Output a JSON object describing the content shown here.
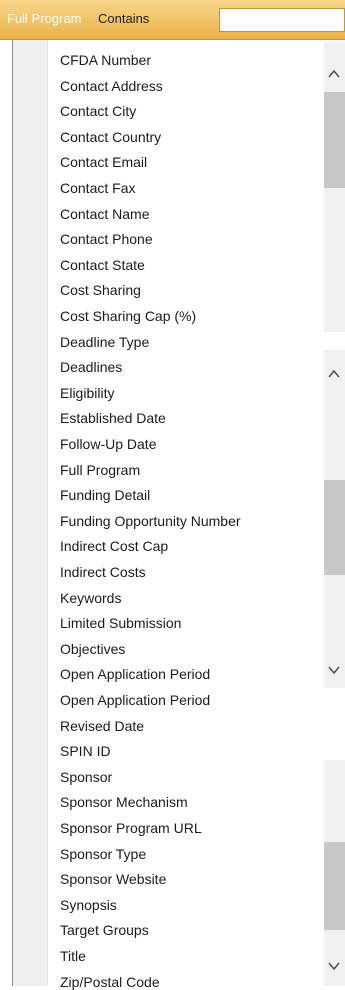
{
  "filter": {
    "field": "Full Program",
    "operator": "Contains",
    "value": ""
  },
  "options": [
    "CFDA Number",
    "Contact Address",
    "Contact City",
    "Contact Country",
    "Contact Email",
    "Contact Fax",
    "Contact Name",
    "Contact Phone",
    "Contact State",
    "Cost Sharing",
    "Cost Sharing Cap (%)",
    "Deadline Type",
    "Deadlines",
    "Eligibility",
    "Established Date",
    "Follow-Up Date",
    "Full Program",
    "Funding Detail",
    "Funding Opportunity Number",
    "Indirect Cost Cap",
    "Indirect Costs",
    "Keywords",
    "Limited Submission",
    "Objectives",
    "Open Application Period",
    "Open Application Period",
    "Revised Date",
    "SPIN ID",
    "Sponsor",
    "Sponsor Mechanism",
    "Sponsor Program URL",
    "Sponsor Type",
    "Sponsor Website",
    "Synopsis",
    "Target Groups",
    "Title",
    "Zip/Postal Code"
  ],
  "icons": {
    "scroll_up": "chevron-up-icon",
    "scroll_down": "chevron-down-icon"
  }
}
